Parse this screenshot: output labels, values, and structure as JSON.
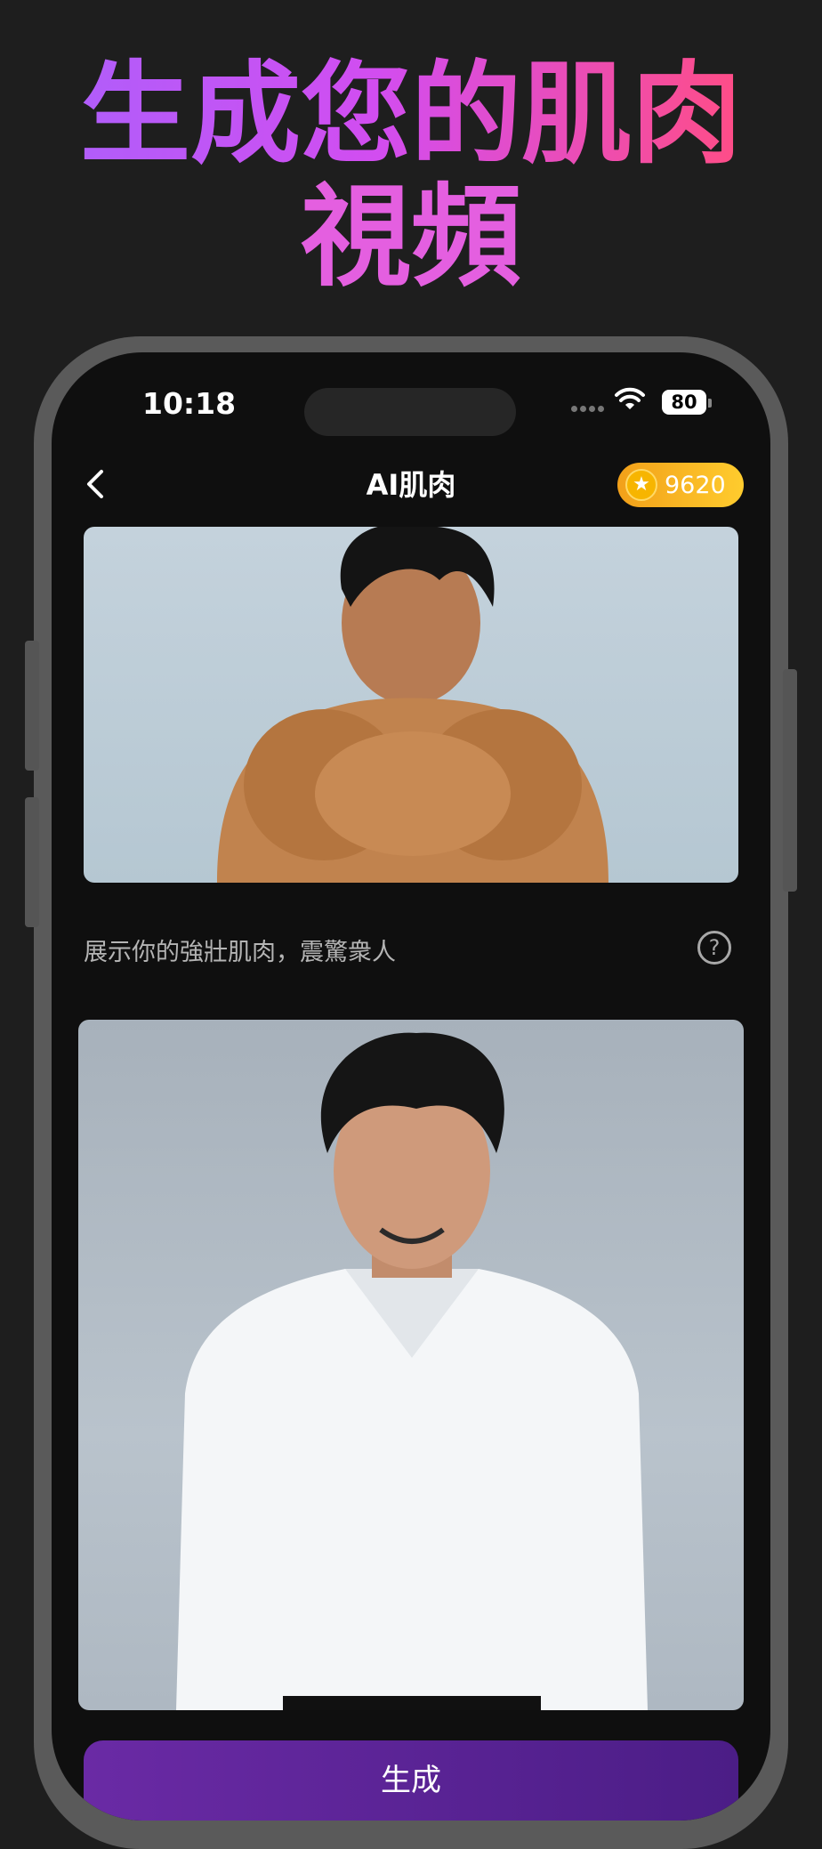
{
  "headline": {
    "line1": "生成您的肌肉",
    "line2": "視頻"
  },
  "status_bar": {
    "time": "10:18",
    "battery": "80"
  },
  "nav": {
    "back_icon": "chevron-left-icon",
    "title": "AI肌肉",
    "coins": "9620",
    "coin_icon": "star-coin-icon"
  },
  "preview": {
    "alt": "muscular shirtless man flexing"
  },
  "caption": {
    "text": "展示你的強壯肌肉，震驚衆人",
    "help_icon": "question-icon"
  },
  "upload": {
    "alt": "man in white shirt portrait"
  },
  "action": {
    "generate_label": "生成"
  },
  "colors": {
    "coin_pill": "#f2a019",
    "generate_button": "#6a2aa5",
    "headline_gradient_start": "#b15dfa",
    "headline_gradient_end": "#ff4d86"
  }
}
